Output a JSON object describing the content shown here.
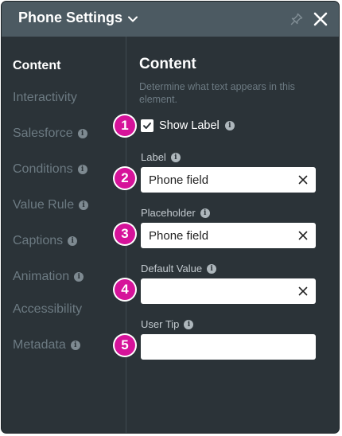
{
  "header": {
    "title": "Phone Settings"
  },
  "sidebar": {
    "items": [
      {
        "label": "Content",
        "active": true,
        "info": false
      },
      {
        "label": "Interactivity",
        "active": false,
        "info": false
      },
      {
        "label": "Salesforce",
        "active": false,
        "info": true
      },
      {
        "label": "Conditions",
        "active": false,
        "info": true
      },
      {
        "label": "Value Rule",
        "active": false,
        "info": true
      },
      {
        "label": "Captions",
        "active": false,
        "info": true
      },
      {
        "label": "Animation",
        "active": false,
        "info": true
      },
      {
        "label": "Accessibility",
        "active": false,
        "info": false
      },
      {
        "label": "Metadata",
        "active": false,
        "info": true
      }
    ]
  },
  "content": {
    "title": "Content",
    "description": "Determine what text appears in this element.",
    "show_label": {
      "label": "Show Label",
      "checked": true
    },
    "fields": [
      {
        "label": "Label",
        "value": "Phone field",
        "clearable": true
      },
      {
        "label": "Placeholder",
        "value": "Phone field",
        "clearable": true
      },
      {
        "label": "Default Value",
        "value": "",
        "clearable": true
      },
      {
        "label": "User Tip",
        "value": "",
        "clearable": false
      }
    ]
  },
  "badges": [
    "1",
    "2",
    "3",
    "4",
    "5"
  ],
  "colors": {
    "panel": "#2b3338",
    "header": "#4c5a62",
    "badge": "#d6139a",
    "muted_text": "#6c7a82"
  }
}
